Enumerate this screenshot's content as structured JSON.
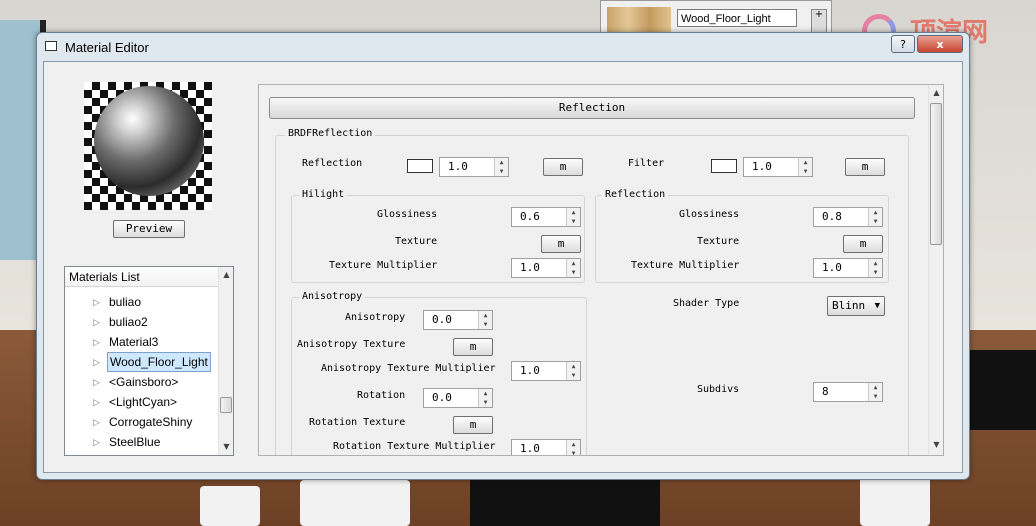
{
  "background": {
    "material_name_field": "Wood_Floor_Light",
    "add_button": "+",
    "logo_text": "顶渲网"
  },
  "window": {
    "title": "Material Editor",
    "help_button": "?",
    "close_button": "x"
  },
  "preview": {
    "button_label": "Preview"
  },
  "materials_list": {
    "header": "Materials List",
    "items": [
      {
        "label": "buliao",
        "selected": false
      },
      {
        "label": "buliao2",
        "selected": false
      },
      {
        "label": "Material3",
        "selected": false
      },
      {
        "label": "Wood_Floor_Light",
        "selected": true
      },
      {
        "label": "<Gainsboro>",
        "selected": false
      },
      {
        "label": "<LightCyan>",
        "selected": false
      },
      {
        "label": "CorrogateShiny",
        "selected": false
      },
      {
        "label": "SteelBlue",
        "selected": false
      }
    ]
  },
  "reflection_panel": {
    "rollout_title": "Reflection",
    "brdf_group_title": "BRDFReflection",
    "reflection_label": "Reflection",
    "reflection_value": "1.0",
    "reflection_map_button": "m",
    "filter_label": "Filter",
    "filter_value": "1.0",
    "filter_map_button": "m",
    "hilight": {
      "title": "Hilight",
      "glossiness_label": "Glossiness",
      "glossiness_value": "0.6",
      "texture_label": "Texture",
      "texture_button": "m",
      "multiplier_label": "Texture Multiplier",
      "multiplier_value": "1.0"
    },
    "reflection_sub": {
      "title": "Reflection",
      "glossiness_label": "Glossiness",
      "glossiness_value": "0.8",
      "texture_label": "Texture",
      "texture_button": "m",
      "multiplier_label": "Texture Multiplier",
      "multiplier_value": "1.0"
    },
    "anisotropy": {
      "title": "Anisotropy",
      "anisotropy_label": "Anisotropy",
      "anisotropy_value": "0.0",
      "texture_label": "Anisotropy Texture",
      "texture_button": "m",
      "multiplier_label": "Anisotropy Texture Multiplier",
      "multiplier_value": "1.0",
      "rotation_label": "Rotation",
      "rotation_value": "0.0",
      "rotation_texture_label": "Rotation Texture",
      "rotation_texture_button": "m",
      "rotation_multiplier_label": "Rotation Texture Multiplier",
      "rotation_multiplier_value": "1.0"
    },
    "shader_type_label": "Shader Type",
    "shader_type_value": "Blinn",
    "subdivs_label": "Subdivs",
    "subdivs_value": "8"
  }
}
